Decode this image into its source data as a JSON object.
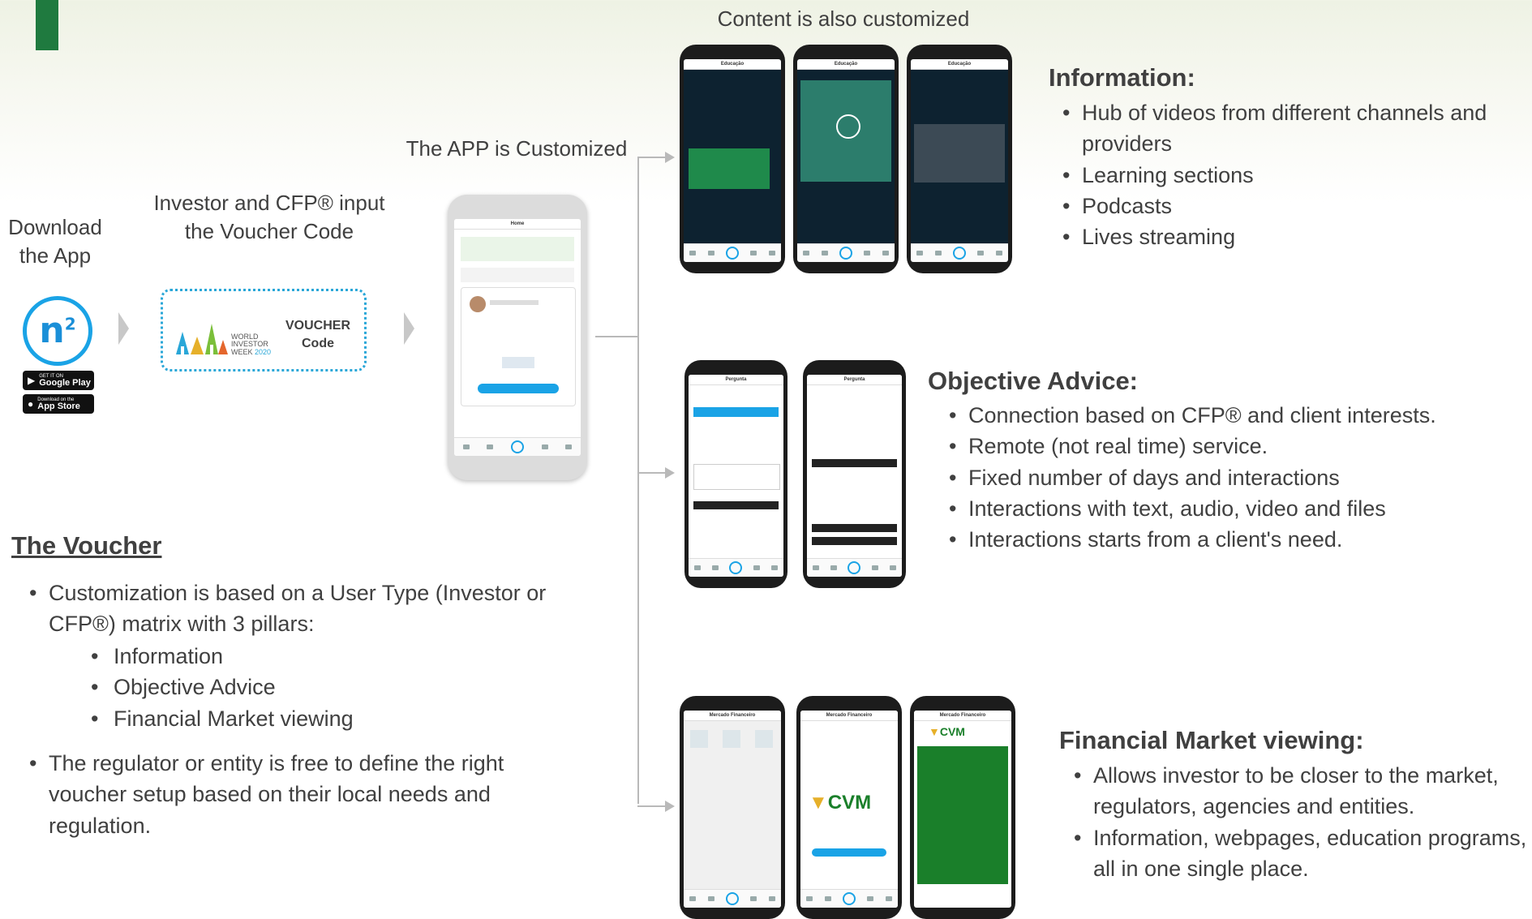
{
  "flow": {
    "download_label": "Download the App",
    "voucher_input_label": "Investor and CFP® input the Voucher Code",
    "app_customized_label": "The APP is Customized",
    "content_customized_label": "Content is also customized"
  },
  "app_logo": {
    "text": "n",
    "superscript": "2"
  },
  "store_badges": {
    "google": {
      "small": "GET IT ON",
      "big": "Google Play"
    },
    "apple": {
      "small": "Download on the",
      "big": "App Store"
    }
  },
  "voucher_card": {
    "logo_text": [
      "WORLD",
      "INVESTOR",
      "WEEK"
    ],
    "logo_year": "2020",
    "code_label_1": "VOUCHER",
    "code_label_2": "Code"
  },
  "voucher_section": {
    "heading": "The Voucher",
    "bullets": [
      "Customization is based on a User Type (Investor or CFP®) matrix with 3 pillars:"
    ],
    "pillars": [
      "Information",
      "Objective Advice",
      "Financial Market viewing"
    ],
    "bullets_2": [
      "The regulator or entity is free to define the right voucher setup based on their local needs and regulation."
    ]
  },
  "information": {
    "heading": "Information:",
    "bullets": [
      "Hub of videos from different channels and providers",
      "Learning sections",
      "Podcasts",
      "Lives streaming"
    ]
  },
  "objective_advice": {
    "heading": "Objective Advice:",
    "bullets": [
      "Connection based on CFP® and client interests.",
      "Remote (not real time) service.",
      "Fixed number of days and interactions",
      "Interactions with text, audio, video and files",
      "Interactions starts from a client's need."
    ]
  },
  "financial_market": {
    "heading": "Financial Market viewing:",
    "bullets": [
      "Allows investor to be closer to the market, regulators, agencies and entities.",
      "Information, webpages, education programs, all in one single place."
    ]
  },
  "phone_screens": {
    "main": "Home",
    "education": "Educação",
    "questions": "Pergunta",
    "market": "Mercado Financeiro",
    "cvm": "CVM"
  },
  "colors": {
    "accent": "#1f7a3f",
    "brand_blue": "#1aa3e6",
    "text": "#404040",
    "connector": "#b9b9b9"
  }
}
